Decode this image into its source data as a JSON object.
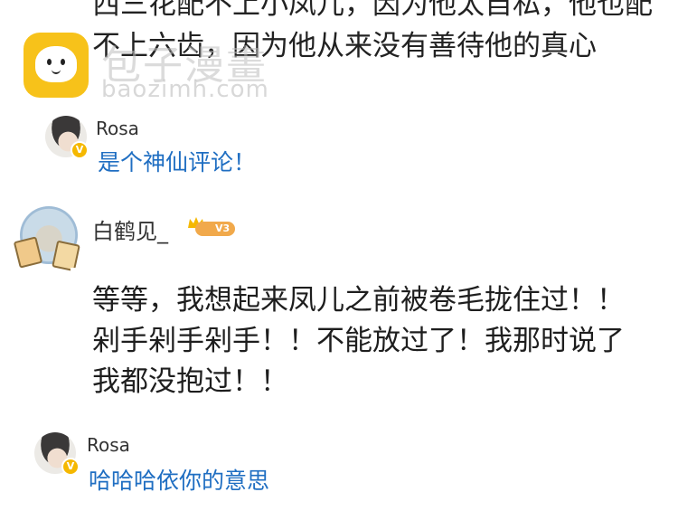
{
  "previous_comment": {
    "text": "西三花配不上小凤儿，因为他太自私，他也配不上六齿，因为他从来没有善待他的真心"
  },
  "watermark": {
    "site_name": "包子漫畫",
    "url": "baozimh.com"
  },
  "reply_1": {
    "user": "Rosa",
    "text": "是个神仙评论！",
    "badge": "V"
  },
  "comment": {
    "user": "白鹤见_",
    "level": "V3",
    "text": "等等，我想起来凤儿之前被卷毛拢住过！！剁手剁手剁手！！不能放过了！我那时说了我都没抱过！！"
  },
  "reply_2": {
    "user": "Rosa",
    "text": "哈哈哈依你的意思",
    "badge": "V"
  },
  "colors": {
    "reply_text": "#1f6ec2",
    "badge_gold": "#f5b800",
    "level_badge": "#f1a94b",
    "watermark_logo": "#f7c21a"
  }
}
